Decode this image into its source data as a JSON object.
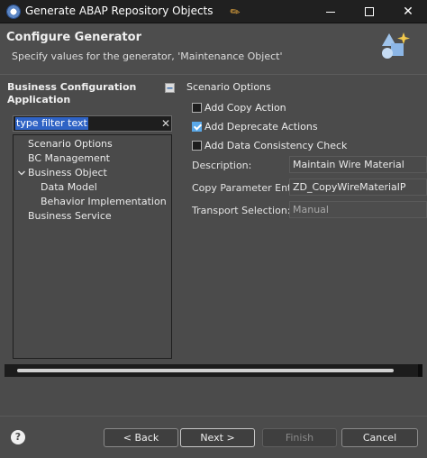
{
  "window": {
    "title": "Generate ABAP Repository Objects",
    "app_icon": "eclipse-icon",
    "pin_icon": "pin-icon",
    "controls": [
      "minimize",
      "maximize",
      "close"
    ],
    "close_glyph": "✕"
  },
  "header": {
    "title": "Configure Generator",
    "description": "Specify values for the generator, 'Maintenance Object'",
    "icon": "wizard-shapes-icon"
  },
  "left_panel": {
    "title": "Business Configuration Application",
    "filter": {
      "value": "type filter text",
      "clear_glyph": "✕"
    },
    "tree": [
      {
        "label": "Scenario Options",
        "level": 1
      },
      {
        "label": "BC Management",
        "level": 1
      },
      {
        "label": "Business Object",
        "level": 1,
        "expanded": true
      },
      {
        "label": "Data Model",
        "level": 2
      },
      {
        "label": "Behavior Implementation",
        "level": 2
      },
      {
        "label": "Business Service",
        "level": 1
      }
    ]
  },
  "right_panel": {
    "title": "Scenario Options",
    "checkboxes": [
      {
        "label": "Add Copy Action",
        "checked": false
      },
      {
        "label": "Add Deprecate Actions",
        "checked": true
      },
      {
        "label": "Add Data Consistency Check",
        "checked": false
      }
    ],
    "fields": [
      {
        "label": "Description:",
        "value": "Maintain Wire Material",
        "disabled": false
      },
      {
        "label": "Copy Parameter Entity:",
        "value": "ZD_CopyWireMaterialP",
        "disabled": false
      },
      {
        "label": "Transport Selection: *",
        "value": "Manual",
        "disabled": true
      }
    ]
  },
  "progress": {
    "fraction": 0.95
  },
  "footer": {
    "help_glyph": "?",
    "back_label": "< Back",
    "next_label": "Next >",
    "finish_label": "Finish",
    "cancel_label": "Cancel"
  },
  "colors": {
    "accent": "#2f63c5",
    "checkbox_checked": "#5aa8e8",
    "pin": "#e9a93f"
  }
}
